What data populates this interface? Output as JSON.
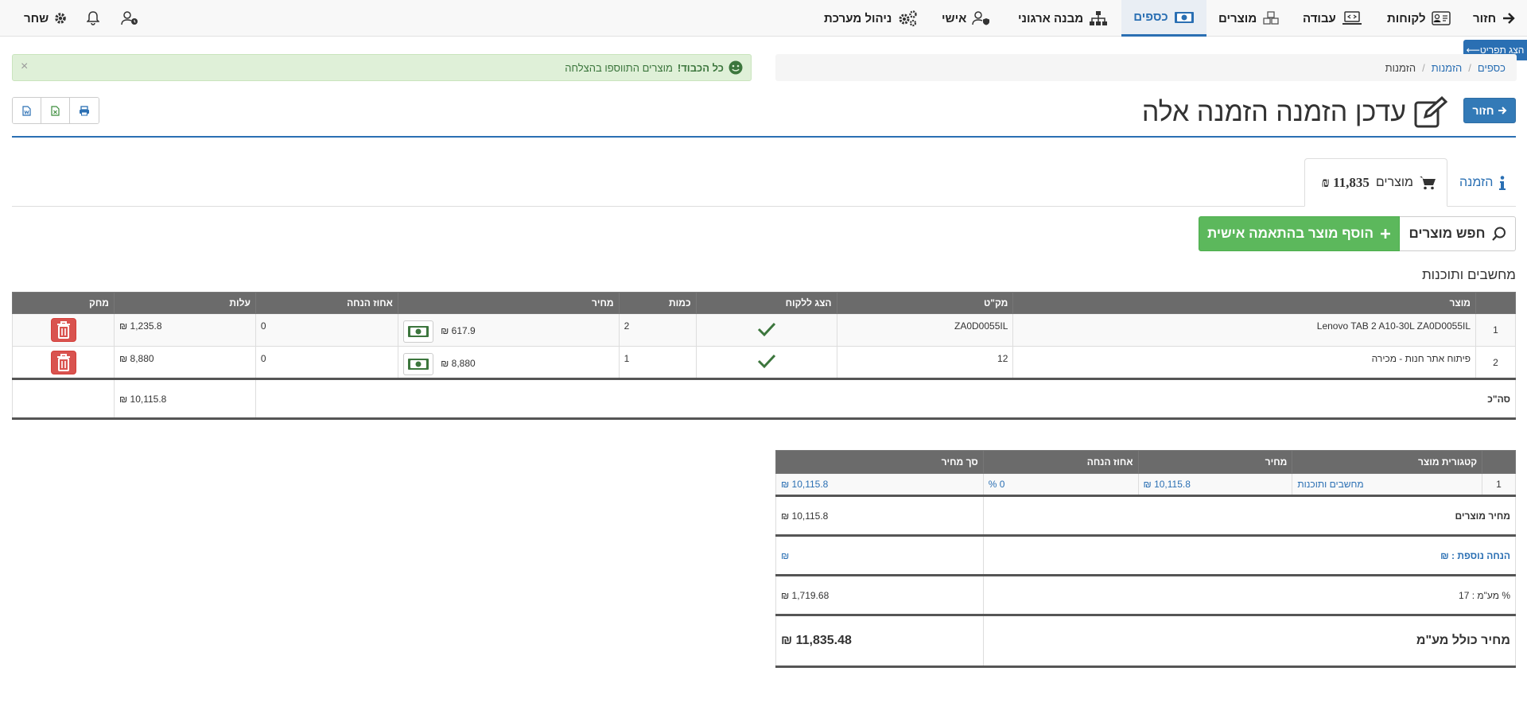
{
  "nav": {
    "back": "חזור",
    "customers": "לקוחות",
    "work": "עבודה",
    "products": "מוצרים",
    "money": "כספים",
    "org": "מבנה ארגוני",
    "personal": "אישי",
    "admin": "ניהול מערכת",
    "user": "שחר"
  },
  "side_tab": "הצג תפריט⟵",
  "breadcrumb": {
    "items": [
      "כספים",
      "הזמנות",
      "הזמנות"
    ]
  },
  "alert": {
    "strong": "כל הכבוד!",
    "text": "מוצרים התווספו בהצלחה",
    "close": "×"
  },
  "header": {
    "back_button": "חזור",
    "title": "עדכן הזמנה הזמנה אלה"
  },
  "tabs": {
    "order": "הזמנה",
    "products": "מוצרים",
    "products_amount": "11,835 ₪"
  },
  "actions": {
    "search": "חפש מוצרים",
    "add": "הוסף מוצר בהתאמה אישית"
  },
  "section_title": "מחשבים ותוכנות",
  "items_table": {
    "headers": [
      "",
      "מוצר",
      "מק\"ט",
      "הצג ללקוח",
      "כמות",
      "מחיר",
      "אחוז הנחה",
      "עלות",
      "מחק"
    ],
    "rows": [
      {
        "num": "1",
        "product": "Lenovo TAB 2 A10-30L ZA0D0055IL",
        "sku": "ZA0D0055IL",
        "qty": "2",
        "price": "617.9 ₪",
        "discount": "0",
        "cost": "1,235.8 ₪"
      },
      {
        "num": "2",
        "product": "פיתוח אתר חנות - מכירה",
        "sku": "12",
        "qty": "1",
        "price": "8,880 ₪",
        "discount": "0",
        "cost": "8,880 ₪"
      }
    ],
    "total_label": "סה\"כ",
    "total_value": "10,115.8 ₪"
  },
  "summary_table": {
    "headers": [
      "",
      "קטגורית מוצר",
      "מחיר",
      "אחוז הנחה",
      "סך מחיר"
    ],
    "row": {
      "num": "1",
      "category": "מחשבים ותוכנות",
      "price": "10,115.8 ₪",
      "discount": "0 %",
      "total": "10,115.8 ₪"
    },
    "products_price_label": "מחיר מוצרים",
    "products_price_value": "10,115.8 ₪",
    "extra_discount_label": "הנחה נוספת : ₪",
    "extra_discount_value": "₪",
    "vat_label": "% מע\"מ : 17",
    "vat_value": "1,719.68 ₪",
    "grand_total_label": "מחיר כולל מע\"מ",
    "grand_total_value": "11,835.48 ₪"
  }
}
